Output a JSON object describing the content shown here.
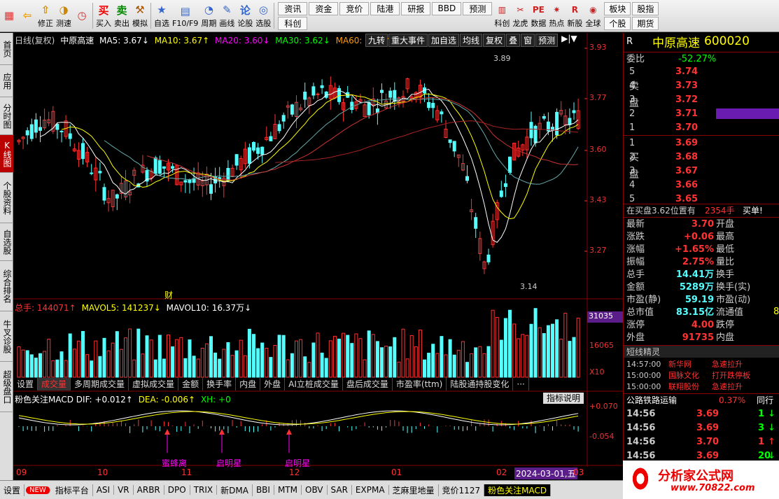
{
  "toolbar": {
    "buttons": [
      {
        "name": "menu-button",
        "label": "",
        "icon": "▦",
        "color": "#d33"
      },
      {
        "name": "back-button",
        "label": "",
        "icon": "⇦",
        "color": "#e90"
      },
      {
        "name": "fix-button",
        "label": "修正",
        "icon": "⇧",
        "color": "#c80"
      },
      {
        "name": "speed-button",
        "label": "测速",
        "icon": "◑",
        "color": "#c80"
      },
      {
        "name": "clock-button",
        "label": "",
        "icon": "◷",
        "color": "#c33"
      },
      {
        "name": "buy-button",
        "label": "买入",
        "icon": "买",
        "color": "#e00"
      },
      {
        "name": "sell-button",
        "label": "卖出",
        "icon": "卖",
        "color": "#080"
      },
      {
        "name": "simulate-button",
        "label": "模拟",
        "icon": "⚒",
        "color": "#a50"
      },
      {
        "name": "watchlist-button",
        "label": "自选",
        "icon": "★",
        "color": "#36c"
      },
      {
        "name": "f10-button",
        "label": "F10/F9",
        "icon": "▤",
        "color": "#36c"
      },
      {
        "name": "period-button",
        "label": "周期",
        "icon": "◔",
        "color": "#36c"
      },
      {
        "name": "draw-button",
        "label": "画线",
        "icon": "✎",
        "color": "#36c"
      },
      {
        "name": "stock-discuss-button",
        "label": "论股",
        "icon": "论",
        "color": "#36c"
      },
      {
        "name": "select-stock-button",
        "label": "选股",
        "icon": "◎",
        "color": "#36c"
      }
    ],
    "grid": [
      "资讯",
      "资金",
      "竞价",
      "陆港",
      "研报",
      "BBD",
      "预测",
      "科创"
    ],
    "right": [
      {
        "name": "kechuang-button",
        "label": "科创",
        "icon": "▥"
      },
      {
        "name": "dragon-button",
        "label": "龙虎",
        "icon": "✂"
      },
      {
        "name": "data-button",
        "label": "数据",
        "icon": "PE"
      },
      {
        "name": "hot-button",
        "label": "热点",
        "icon": "✷"
      },
      {
        "name": "new-stock-button",
        "label": "新股",
        "icon": "R"
      },
      {
        "name": "global-button",
        "label": "全球",
        "icon": "◉"
      }
    ],
    "grid2": [
      "板块",
      "股指",
      "个股",
      "期货"
    ]
  },
  "sidebar": [
    "首页",
    "应用",
    "分时图",
    "K线图",
    "个股资料",
    "自选股",
    "综合排名",
    "牛叉诊股",
    "超级盘口"
  ],
  "chart": {
    "header": {
      "period": "日线(复权)",
      "name": "中原高速",
      "ma5": "MA5: 3.67↓",
      "ma10": "MA10: 3.67↑",
      "ma20": "MA20: 3.60↓",
      "ma30": "MA30: 3.62↓",
      "ma60": "MA60: 3.66↑"
    },
    "tools": [
      "九转",
      "重大事件",
      "加自选",
      "均线",
      "复权",
      "叠",
      "窗",
      "预测"
    ],
    "max_label": "3.89",
    "min_label": "3.14",
    "fin_mark": "财",
    "y_labels": [
      "3.93",
      "3.77",
      "3.60",
      "3.43",
      "3.27",
      "3.14"
    ],
    "vol": {
      "label": "总手: 144071↑",
      "mavol5": "MAVOL5: 141237↓",
      "mavol10": "MAVOL10: 16.37万↓",
      "y1": "31035",
      "y2": "16065",
      "y3": "X10"
    },
    "subtabs": [
      "设置",
      "成交量",
      "多周期成交量",
      "虚拟成交量",
      "金额",
      "换手率",
      "内盘",
      "外盘",
      "AI立桩成交量",
      "盘后成交量",
      "市盈率(ttm)",
      "陆股通持股变化",
      "···"
    ],
    "macd": {
      "label": "粉色关注MACD DIF: +0.012↑",
      "dea": "DEA: -0.006↑",
      "xh": "XH: +0",
      "btn": "指标说明",
      "y1": "+0.070",
      "y2": "-0.054",
      "signals": [
        "蜜蜂离",
        "启明星",
        "启明星"
      ]
    },
    "months": [
      "09",
      "10",
      "11",
      "12",
      "01",
      "02",
      "2024-03-01,五",
      "03"
    ]
  },
  "right_panel": {
    "code_r": "R",
    "name": "中原高速",
    "code": "600020",
    "wei_bi_label": "委比",
    "wei_bi": "-52.27%",
    "sell_label": "卖盘",
    "buy_label": "买盘",
    "sell": [
      {
        "n": "5",
        "p": "3.74"
      },
      {
        "n": "4",
        "p": "3.73"
      },
      {
        "n": "3",
        "p": "3.72"
      },
      {
        "n": "2",
        "p": "3.71"
      },
      {
        "n": "1",
        "p": "3.70"
      }
    ],
    "buy": [
      {
        "n": "1",
        "p": "3.69"
      },
      {
        "n": "2",
        "p": "3.68"
      },
      {
        "n": "3",
        "p": "3.67"
      },
      {
        "n": "4",
        "p": "3.66"
      },
      {
        "n": "5",
        "p": "3.65"
      }
    ],
    "pos": "在买盘3.62位置有",
    "pos_qty": "2354手",
    "pos_act": "买单!",
    "quote": [
      {
        "l": "最新",
        "v": "3.70",
        "r": "开盘"
      },
      {
        "l": "涨跌",
        "v": "+0.06",
        "r": "最高"
      },
      {
        "l": "涨幅",
        "v": "+1.65%",
        "r": "最低"
      },
      {
        "l": "振幅",
        "v": "2.75%",
        "r": "量比"
      },
      {
        "l": "总手",
        "v": "14.41万",
        "r": "换手"
      },
      {
        "l": "金额",
        "v": "5289万",
        "r": "换手(实)"
      },
      {
        "l": "市盈(静)",
        "v": "59.19",
        "r": "市盈(动)"
      },
      {
        "l": "总市值",
        "v": "83.15亿",
        "r": "流通值"
      },
      {
        "l": "涨停",
        "v": "4.00",
        "r": "跌停"
      },
      {
        "l": "外盘",
        "v": "91735",
        "r": "内盘"
      }
    ],
    "liutong_tail": "8",
    "news_title": "短线精灵",
    "news": [
      {
        "t": "14:57:00",
        "s": "新华网",
        "e": "急速拉升"
      },
      {
        "t": "15:00:00",
        "s": "国脉文化",
        "e": "打开跌停板"
      },
      {
        "t": "15:00:00",
        "s": "联翔股份",
        "e": "急速拉升"
      }
    ],
    "sector": "公路铁路运输",
    "sector_pct": "0.37%",
    "sector_tab": "同行",
    "ticks": [
      {
        "t": "14:56",
        "p": "3.69",
        "v": "1",
        "d": "down"
      },
      {
        "t": "14:56",
        "p": "3.69",
        "v": "3",
        "d": "down"
      },
      {
        "t": "14:56",
        "p": "3.70",
        "v": "1",
        "d": "up"
      },
      {
        "t": "14:56",
        "p": "3.69",
        "v": "20",
        "d": "down"
      }
    ],
    "watermark": "分析家公式网",
    "watermark_url": "www.70822.com"
  },
  "bottom_tabs": [
    "设置",
    "NEW",
    "指标平台",
    "ASI",
    "VR",
    "ARBR",
    "DPO",
    "TRIX",
    "新DMA",
    "BBI",
    "MTM",
    "OBV",
    "SAR",
    "EXPMA",
    "芝麻里地量",
    "竞价1127",
    "粉色关注MACD"
  ],
  "colors": {
    "up": "#ff3232",
    "down": "#54ffff",
    "ma5": "#ffffff",
    "ma10": "#ffff00",
    "ma20": "#ff00ff",
    "ma30": "#00ff00",
    "ma60": "#ff9900",
    "bg": "#000000"
  }
}
